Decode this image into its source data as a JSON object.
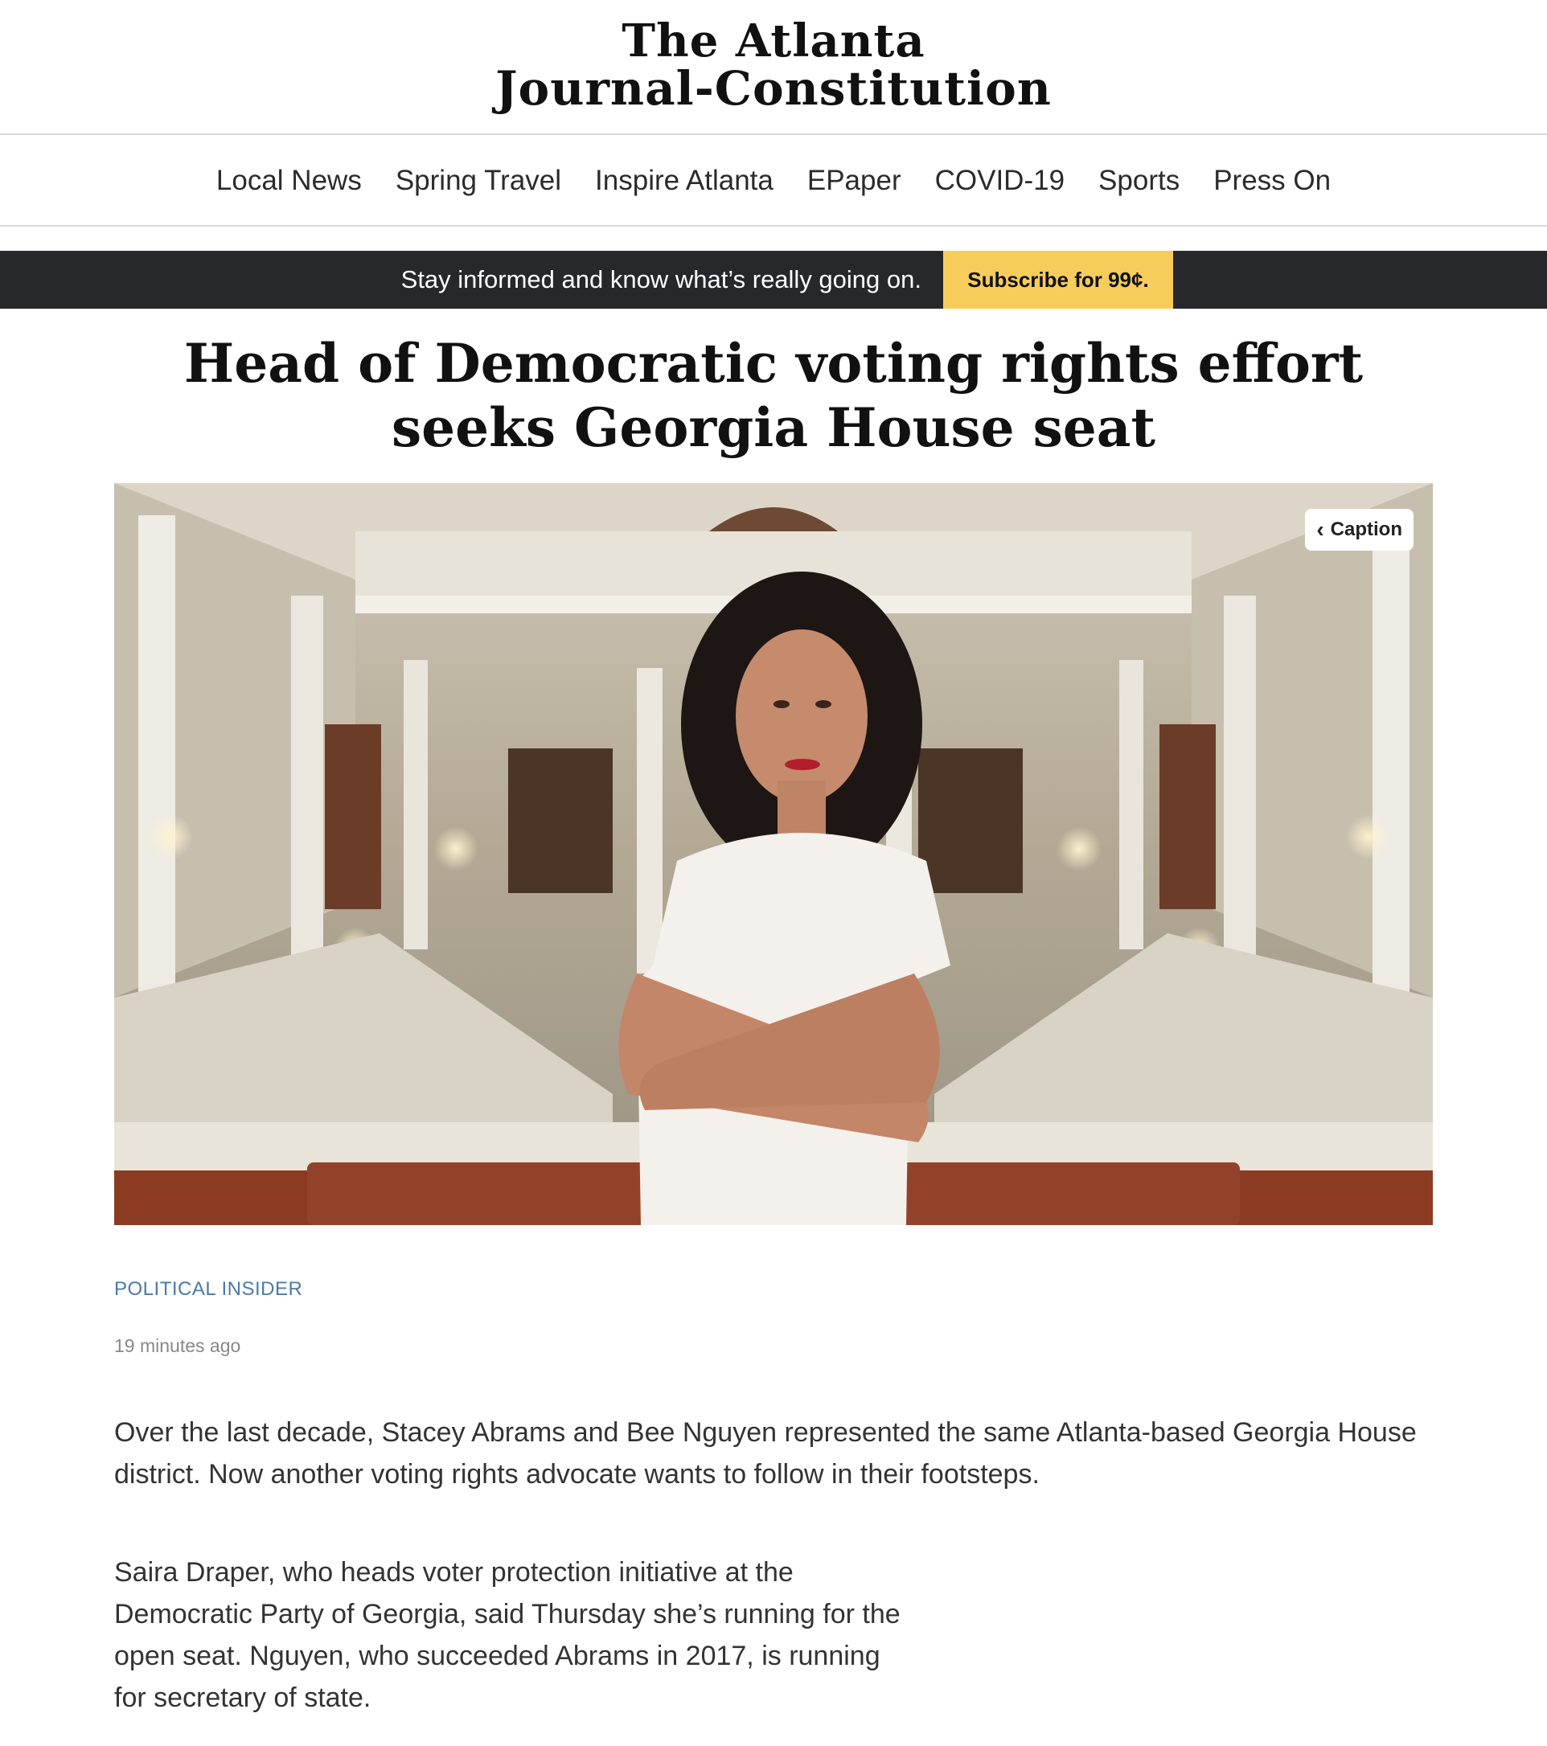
{
  "masthead": {
    "logo_line1": "The Atlanta",
    "logo_line2": "Journal-Constitution"
  },
  "nav": {
    "items": [
      {
        "label": "Local News"
      },
      {
        "label": "Spring Travel"
      },
      {
        "label": "Inspire Atlanta"
      },
      {
        "label": "EPaper"
      },
      {
        "label": "COVID-19"
      },
      {
        "label": "Sports"
      },
      {
        "label": "Press On"
      }
    ]
  },
  "promo": {
    "text": "Stay informed and know what’s really going on.",
    "button_label": "Subscribe for 99¢."
  },
  "article": {
    "headline": "Head of Democratic voting rights effort seeks Georgia House seat",
    "caption_button": "Caption",
    "section": "POLITICAL INSIDER",
    "timestamp": "19 minutes ago",
    "paragraphs": [
      "Over the last decade, Stacey Abrams and Bee Nguyen represented the same Atlanta-based Georgia House district. Now another voting rights advocate wants to follow in their footsteps.",
      "Saira Draper, who heads voter protection initiative at the Democratic Party of Georgia, said Thursday she’s running for the open seat. Nguyen, who succeeded Abrams in 2017, is running for secretary of state."
    ]
  },
  "icons": {
    "caption_chevron": "chevron-left-icon"
  }
}
